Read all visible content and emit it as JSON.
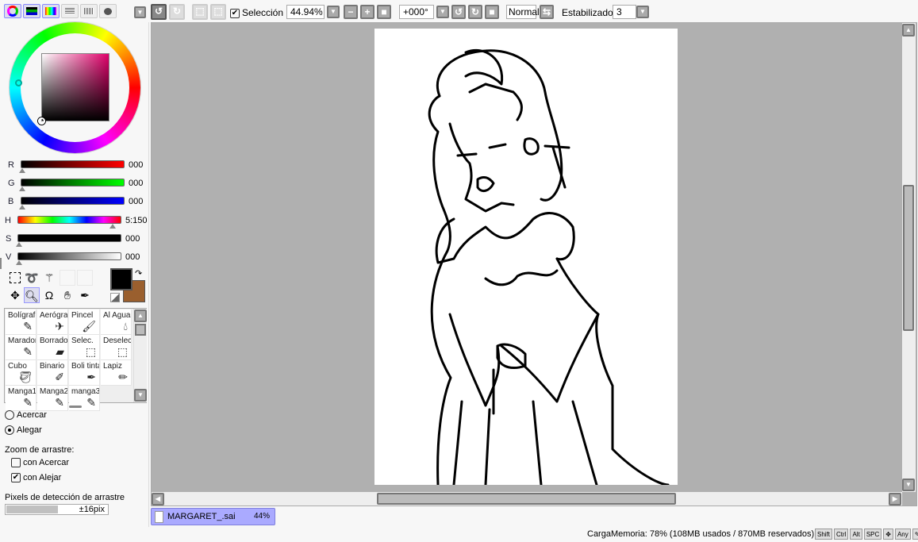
{
  "toolbar": {
    "selection_label": "Selección",
    "selection_checked": true,
    "zoom": "44.94%",
    "rotation": "+000°",
    "blend_mode": "Normal",
    "stabilizer_label": "Estabilizador",
    "stabilizer_value": "3"
  },
  "color": {
    "r": {
      "label": "R",
      "value": "000"
    },
    "g": {
      "label": "G",
      "value": "000"
    },
    "b": {
      "label": "B",
      "value": "000"
    },
    "h": {
      "label": "H",
      "value": "5:150"
    },
    "s": {
      "label": "S",
      "value": "000"
    },
    "v": {
      "label": "V",
      "value": "000"
    },
    "foreground": "#000000",
    "background": "#9a5f2e"
  },
  "brushes": [
    {
      "label": "Bolígrafo",
      "icon": "pen-icon"
    },
    {
      "label": "Aerógrafo",
      "icon": "airbrush-icon"
    },
    {
      "label": "Pincel",
      "icon": "brush-icon"
    },
    {
      "label": "Al Agua",
      "icon": "watercolor-icon"
    },
    {
      "label": "Marador",
      "icon": "marker-icon"
    },
    {
      "label": "Borrador",
      "icon": "eraser-icon"
    },
    {
      "label": "Selec.",
      "icon": "select-pen-icon"
    },
    {
      "label": "Deselec.",
      "icon": "deselect-icon"
    },
    {
      "label": "Cubo",
      "icon": "bucket-icon"
    },
    {
      "label": "Binario",
      "icon": "binary-pen-icon"
    },
    {
      "label": "Boli tinta",
      "icon": "ink-pen-icon"
    },
    {
      "label": "Lapiz",
      "icon": "pencil-icon"
    },
    {
      "label": "Manga1",
      "icon": "pen-icon"
    },
    {
      "label": "Manga2",
      "icon": "pen-icon"
    },
    {
      "label": "manga3",
      "icon": "pen-icon"
    }
  ],
  "zoom_options": {
    "zoom_in": "Acercar",
    "zoom_out": "Alegar",
    "selected": "Alegar",
    "drag_zoom_label": "Zoom de arrastre:",
    "with_zoom_in": "con Acercar",
    "with_zoom_in_checked": false,
    "with_zoom_out": "con Alejar",
    "with_zoom_out_checked": true,
    "drag_pixels_label": "Pixels de detección de arrastre",
    "drag_pixels_value": "±16pix"
  },
  "document_tab": {
    "name": "MARGARET_.sai",
    "zoom": "44%"
  },
  "status": {
    "memory": "CargaMemoria: 78% (108MB usados / 870MB reservados)",
    "keys": [
      "Shift",
      "Ctrl",
      "Alt",
      "SPC",
      "✥",
      "Any",
      "✎"
    ]
  }
}
